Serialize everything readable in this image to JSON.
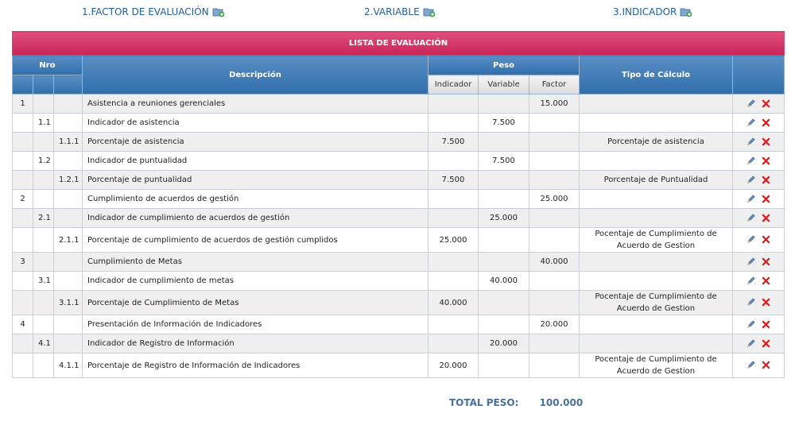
{
  "nav": {
    "factor": "1.FACTOR DE EVALUACIÓN",
    "variable": "2.VARIABLE",
    "indicador": "3.INDICADOR"
  },
  "table": {
    "title": "LISTA DE EVALUACIÓN",
    "headers": {
      "nro": "Nro",
      "descripcion": "Descripción",
      "peso": "Peso",
      "indicador": "Indicador",
      "variable": "Variable",
      "factor": "Factor",
      "tipo": "Tipo de Cálculo"
    },
    "rows": [
      {
        "n1": "1",
        "n2": "",
        "n3": "",
        "desc": "Asistencia a reuniones gerenciales",
        "ind": "",
        "var": "",
        "fac": "15.000",
        "tipo": ""
      },
      {
        "n1": "",
        "n2": "1.1",
        "n3": "",
        "desc": " Indicador de asistencia",
        "ind": "",
        "var": "7.500",
        "fac": "",
        "tipo": ""
      },
      {
        "n1": "",
        "n2": "",
        "n3": "1.1.1",
        "desc": "Porcentaje de asistencia",
        "ind": "7.500",
        "var": "",
        "fac": "",
        "tipo": "Porcentaje de asistencia"
      },
      {
        "n1": "",
        "n2": "1.2",
        "n3": "",
        "desc": "Indicador de puntualidad",
        "ind": "",
        "var": "7.500",
        "fac": "",
        "tipo": ""
      },
      {
        "n1": "",
        "n2": "",
        "n3": "1.2.1",
        "desc": "Porcentaje de puntualidad",
        "ind": "7.500",
        "var": "",
        "fac": "",
        "tipo": "Porcentaje de Puntualidad"
      },
      {
        "n1": "2",
        "n2": "",
        "n3": "",
        "desc": "Cumplimiento de acuerdos de gestión",
        "ind": "",
        "var": "",
        "fac": "25.000",
        "tipo": ""
      },
      {
        "n1": "",
        "n2": "2.1",
        "n3": "",
        "desc": "Indicador de cumplimiento de acuerdos de gestión",
        "ind": "",
        "var": "25.000",
        "fac": "",
        "tipo": ""
      },
      {
        "n1": "",
        "n2": "",
        "n3": "2.1.1",
        "desc": "Porcentaje de cumplimiento de acuerdos de gestión cumplidos",
        "ind": "25.000",
        "var": "",
        "fac": "",
        "tipo": "Pocentaje de Cumplimiento de Acuerdo de Gestion"
      },
      {
        "n1": "3",
        "n2": "",
        "n3": "",
        "desc": "Cumplimiento de Metas",
        "ind": "",
        "var": "",
        "fac": "40.000",
        "tipo": ""
      },
      {
        "n1": "",
        "n2": "3.1",
        "n3": "",
        "desc": "Indicador de cumplimiento de metas",
        "ind": "",
        "var": "40.000",
        "fac": "",
        "tipo": ""
      },
      {
        "n1": "",
        "n2": "",
        "n3": "3.1.1",
        "desc": "Porcentaje de Cumplimiento de Metas",
        "ind": "40.000",
        "var": "",
        "fac": "",
        "tipo": "Pocentaje de Cumplimiento de Acuerdo de Gestion"
      },
      {
        "n1": "4",
        "n2": "",
        "n3": "",
        "desc": " Presentación de Información de Indicadores",
        "ind": "",
        "var": "",
        "fac": "20.000",
        "tipo": ""
      },
      {
        "n1": "",
        "n2": "4.1",
        "n3": "",
        "desc": "Indicador de Registro de Información",
        "ind": "",
        "var": "20.000",
        "fac": "",
        "tipo": ""
      },
      {
        "n1": "",
        "n2": "",
        "n3": "4.1.1",
        "desc": "Porcentaje de Registro de Información de Indicadores",
        "ind": "20.000",
        "var": "",
        "fac": "",
        "tipo": "Pocentaje de Cumplimiento de Acuerdo de Gestion"
      }
    ]
  },
  "total": {
    "label": "TOTAL PESO:",
    "value": "100.000"
  },
  "icons": {
    "add": "add-folder-icon",
    "edit": "pencil-icon",
    "delete": "delete-x-icon"
  },
  "colors": {
    "title_bar": "#d23564",
    "header": "#3f7bb6",
    "link": "#1f5e9c",
    "delete": "#d42020"
  }
}
